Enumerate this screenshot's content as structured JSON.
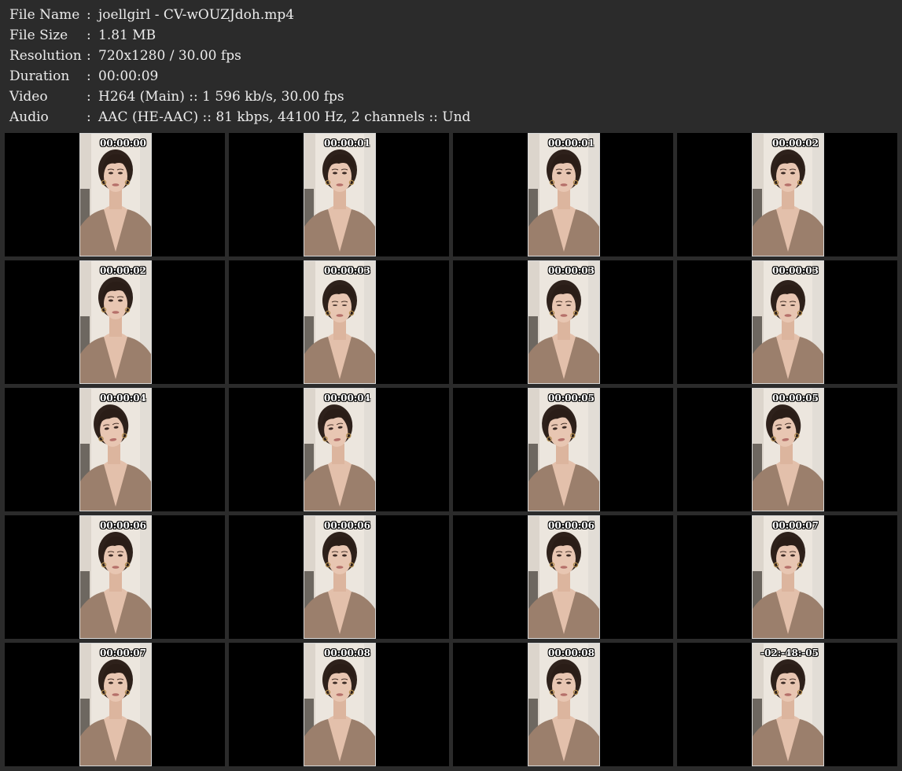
{
  "info": [
    {
      "key": "File Name",
      "sep": ":",
      "value": "joellgirl - CV-wOUZJdoh.mp4"
    },
    {
      "key": "File Size",
      "sep": ":",
      "value": "1.81 MB"
    },
    {
      "key": "Resolution",
      "sep": ":",
      "value": "720x1280 / 30.00 fps"
    },
    {
      "key": "Duration",
      "sep": ":",
      "value": "00:00:09"
    },
    {
      "key": "Video",
      "sep": ":",
      "value": "H264 (Main) :: 1 596 kb/s, 30.00 fps"
    },
    {
      "key": "Audio",
      "sep": ":",
      "value": "AAC (HE-AAC) :: 81 kbps, 44100 Hz, 2 channels :: Und"
    }
  ],
  "thumbnails": [
    {
      "timecode": "00:00:00",
      "head": "front"
    },
    {
      "timecode": "00:00:01",
      "head": "front"
    },
    {
      "timecode": "00:00:01",
      "head": "front"
    },
    {
      "timecode": "00:00:02",
      "head": "front"
    },
    {
      "timecode": "00:00:02",
      "head": "front"
    },
    {
      "timecode": "00:00:03",
      "head": "down"
    },
    {
      "timecode": "00:00:03",
      "head": "down"
    },
    {
      "timecode": "00:00:03",
      "head": "down"
    },
    {
      "timecode": "00:00:04",
      "head": "left"
    },
    {
      "timecode": "00:00:04",
      "head": "left"
    },
    {
      "timecode": "00:00:05",
      "head": "left"
    },
    {
      "timecode": "00:00:05",
      "head": "left"
    },
    {
      "timecode": "00:00:06",
      "head": "front"
    },
    {
      "timecode": "00:00:06",
      "head": "front"
    },
    {
      "timecode": "00:00:06",
      "head": "front"
    },
    {
      "timecode": "00:00:07",
      "head": "front"
    },
    {
      "timecode": "00:00:07",
      "head": "front"
    },
    {
      "timecode": "00:00:08",
      "head": "front"
    },
    {
      "timecode": "00:00:08",
      "head": "front"
    },
    {
      "timecode": "-02:-48:-05",
      "head": "front"
    }
  ],
  "colors": {
    "page_background": "#2b2b2b",
    "info_text": "#ececec",
    "cell_background": "#000000",
    "timecode_text": "#ffffff"
  }
}
